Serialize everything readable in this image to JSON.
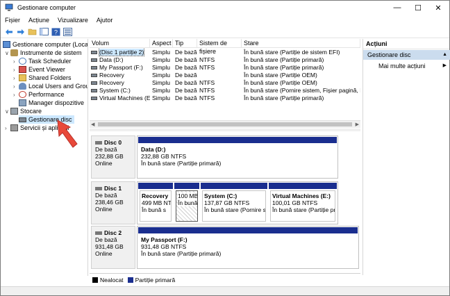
{
  "window": {
    "title": "Gestionare computer"
  },
  "menu": [
    "Fișier",
    "Acțiune",
    "Vizualizare",
    "Ajutor"
  ],
  "tree": {
    "root": "Gestionare computer (Local)",
    "system_tools": "Instrumente de sistem",
    "task_scheduler": "Task Scheduler",
    "event_viewer": "Event Viewer",
    "shared_folders": "Shared Folders",
    "local_users": "Local Users and Groups",
    "performance": "Performance",
    "device_manager": "Manager dispozitive",
    "storage": "Stocare",
    "disk_management": "Gestionare disc",
    "services": "Servicii și aplicații"
  },
  "volumes": {
    "columns": [
      "Volum",
      "Aspect",
      "Tip",
      "Sistem de fișiere",
      "Stare"
    ],
    "rows": [
      {
        "name": "(Disc 1 partiție 2)",
        "layout": "Simplu",
        "type": "De bază",
        "fs": "",
        "status": "În bună stare (Partiție de sistem EFI)"
      },
      {
        "name": "Data (D:)",
        "layout": "Simplu",
        "type": "De bază",
        "fs": "NTFS",
        "status": "În bună stare (Partiție primară)"
      },
      {
        "name": "My Passport (F:)",
        "layout": "Simplu",
        "type": "De bază",
        "fs": "NTFS",
        "status": "În bună stare (Partiție primară)"
      },
      {
        "name": "Recovery",
        "layout": "Simplu",
        "type": "De bază",
        "fs": "",
        "status": "În bună stare (Partiție OEM)"
      },
      {
        "name": "Recovery",
        "layout": "Simplu",
        "type": "De bază",
        "fs": "NTFS",
        "status": "În bună stare (Partiție OEM)"
      },
      {
        "name": "System (C:)",
        "layout": "Simplu",
        "type": "De bază",
        "fs": "NTFS",
        "status": "În bună stare (Pornire sistem, Fișier pagină, Dump"
      },
      {
        "name": "Virtual Machines (E:)",
        "layout": "Simplu",
        "type": "De bază",
        "fs": "NTFS",
        "status": "În bună stare (Partiție primară)"
      }
    ]
  },
  "disks": [
    {
      "name": "Disc 0",
      "type": "De bază",
      "size": "232,88 GB",
      "state": "Online",
      "partitions": [
        {
          "title": "Data  (D:)",
          "size": "232,88 GB NTFS",
          "status": "În bună stare (Partiție primară)"
        }
      ]
    },
    {
      "name": "Disc 1",
      "type": "De bază",
      "size": "238,46 GB",
      "state": "Online",
      "partitions": [
        {
          "title": "Recovery",
          "size": "499 MB NTF",
          "status": "În bună s"
        },
        {
          "title": "",
          "size": "100 MB",
          "status": "În bună"
        },
        {
          "title": "System  (C:)",
          "size": "137,87 GB NTFS",
          "status": "În bună stare (Pornire siste"
        },
        {
          "title": "Virtual Machines  (E:)",
          "size": "100,01 GB NTFS",
          "status": "În bună stare (Partiție primar"
        }
      ]
    },
    {
      "name": "Disc 2",
      "type": "De bază",
      "size": "931,48 GB",
      "state": "Online",
      "partitions": [
        {
          "title": "My Passport  (F:)",
          "size": "931,48 GB NTFS",
          "status": "În bună stare (Partiție primară)"
        }
      ]
    }
  ],
  "legend": {
    "unallocated": "Nealocat",
    "primary": "Partiție primară",
    "unallocated_color": "#000000",
    "primary_color": "#1a2e8f"
  },
  "actions": {
    "header": "Acțiuni",
    "section": "Gestionare disc",
    "more": "Mai multe acțiuni"
  }
}
